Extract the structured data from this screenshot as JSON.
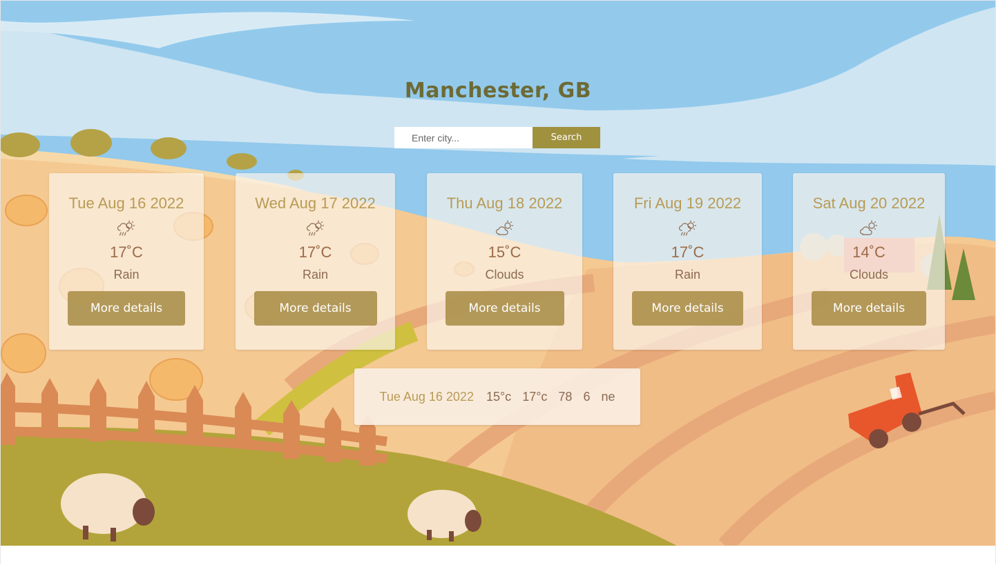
{
  "header": {
    "city": "Manchester, GB"
  },
  "search": {
    "placeholder": "Enter city...",
    "button_label": "Search"
  },
  "forecast": [
    {
      "date": "Tue Aug 16 2022",
      "icon": "rain-cloud-sun-icon",
      "temp": "17˚C",
      "condition": "Rain",
      "button_label": "More details"
    },
    {
      "date": "Wed Aug 17 2022",
      "icon": "rain-cloud-sun-icon",
      "temp": "17˚C",
      "condition": "Rain",
      "button_label": "More details"
    },
    {
      "date": "Thu Aug 18 2022",
      "icon": "cloud-sun-icon",
      "temp": "15˚C",
      "condition": "Clouds",
      "button_label": "More details"
    },
    {
      "date": "Fri Aug 19 2022",
      "icon": "rain-cloud-sun-icon",
      "temp": "17˚C",
      "condition": "Rain",
      "button_label": "More details"
    },
    {
      "date": "Sat Aug 20 2022",
      "icon": "cloud-sun-icon",
      "temp": "14˚C",
      "condition": "Clouds",
      "button_label": "More details"
    }
  ],
  "details": {
    "date": "Tue Aug 16 2022",
    "min_temp": "15°c",
    "max_temp": "17°c",
    "humidity": "78",
    "wind_speed": "6",
    "wind_direction": "ne"
  },
  "colors": {
    "accent": "#a0913f",
    "title": "#6d6a35",
    "card_date": "#b89b55",
    "card_text": "#9b6a48"
  }
}
